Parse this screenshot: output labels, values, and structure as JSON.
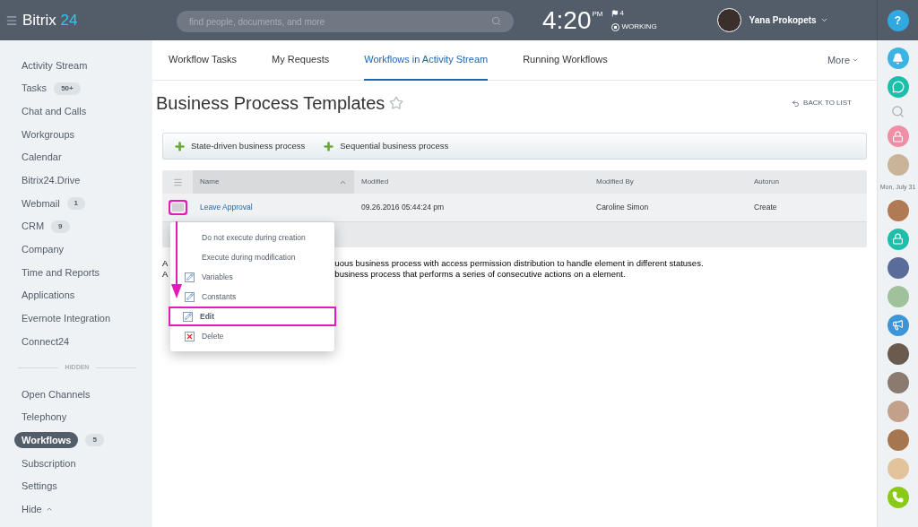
{
  "header": {
    "logo": {
      "word": "Bitrix",
      "number": "24"
    },
    "search": {
      "placeholder": "find people, documents, and more"
    },
    "clock": {
      "time": "4:20",
      "period": "PM",
      "flag_count": "4",
      "status": "WORKING"
    },
    "user": {
      "name": "Yana Prokopets"
    },
    "help": "?"
  },
  "sidebar": {
    "items": [
      {
        "label": "Activity Stream",
        "selected": false
      },
      {
        "label": "Tasks",
        "badge": "50+",
        "selected": false
      },
      {
        "label": "Chat and Calls",
        "selected": false
      },
      {
        "label": "Workgroups",
        "selected": false
      },
      {
        "label": "Calendar",
        "selected": false
      },
      {
        "label": "Bitrix24.Drive",
        "selected": false
      },
      {
        "label": "Webmail",
        "badge": "1",
        "selected": false
      },
      {
        "label": "CRM",
        "badge": "9",
        "selected": false
      },
      {
        "label": "Company",
        "selected": false
      },
      {
        "label": "Time and Reports",
        "selected": false
      },
      {
        "label": "Applications",
        "selected": false
      },
      {
        "label": "Evernote Integration",
        "selected": false
      },
      {
        "label": "Connect24",
        "selected": false
      }
    ],
    "divider": "HIDDEN",
    "hidden_items": [
      {
        "label": "Open Channels",
        "selected": false
      },
      {
        "label": "Telephony",
        "selected": false
      },
      {
        "label": "Workflows",
        "badge": "5",
        "selected": true
      },
      {
        "label": "Subscription",
        "selected": false
      },
      {
        "label": "Settings",
        "selected": false
      }
    ],
    "toggle": "Hide"
  },
  "tabs": [
    {
      "label": "Workflow Tasks",
      "selected": false
    },
    {
      "label": "My Requests",
      "selected": false
    },
    {
      "label": "Workflows in Activity Stream",
      "selected": true
    },
    {
      "label": "Running Workflows",
      "selected": false
    }
  ],
  "more": "More",
  "page_title": "Business Process Templates",
  "back_link": "BACK TO LIST",
  "toolbar": [
    "State-driven business process",
    "Sequential business process"
  ],
  "table": {
    "columns": [
      "Name",
      "Modified",
      "Modified By",
      "Autorun"
    ],
    "rows": [
      {
        "cells": [
          "Leave Approval",
          "09.26.2016 05:44:24 pm",
          "Caroline Simon",
          "Create"
        ]
      }
    ]
  },
  "notes": [
    {
      "start": "A",
      "end": "uous business process with access permission distribution to handle element in different statuses."
    },
    {
      "start": "A",
      "end": "business process that performs a series of consecutive actions on a element."
    }
  ],
  "context_menu": [
    {
      "label": "Do not execute during creation",
      "kind": "plain",
      "selected": false
    },
    {
      "label": "Execute during modification",
      "kind": "plain",
      "selected": false
    },
    {
      "label": "Variables",
      "kind": "edit",
      "selected": false
    },
    {
      "label": "Constants",
      "kind": "edit",
      "selected": false
    },
    {
      "label": "Edit",
      "kind": "edit",
      "selected": true
    },
    {
      "label": "Delete",
      "kind": "delete",
      "selected": false
    }
  ],
  "right_bar": [
    {
      "kind": "bell",
      "color": "#3bb3e4"
    },
    {
      "kind": "chat",
      "color": "#1ebfaa"
    },
    {
      "kind": "search"
    },
    {
      "kind": "lock",
      "color": "#ef8ea5"
    },
    {
      "kind": "avatar",
      "color": "#c9b49a"
    },
    {
      "kind": "date",
      "text": "Mon, July 31"
    },
    {
      "kind": "avatar",
      "color": "#b07a55"
    },
    {
      "kind": "lock",
      "color": "#1ebfaa"
    },
    {
      "kind": "avatar",
      "color": "#5a6c9a"
    },
    {
      "kind": "avatar",
      "color": "#9fc29a"
    },
    {
      "kind": "megaphone",
      "color": "#3c95d6"
    },
    {
      "kind": "avatar",
      "color": "#6b5a4e"
    },
    {
      "kind": "avatar",
      "color": "#8a7a70"
    },
    {
      "kind": "avatar",
      "color": "#c2a08a"
    },
    {
      "kind": "avatar",
      "color": "#a5764f"
    },
    {
      "kind": "avatar",
      "color": "#e3c39b"
    },
    {
      "kind": "phone",
      "color": "#8bc919"
    }
  ]
}
